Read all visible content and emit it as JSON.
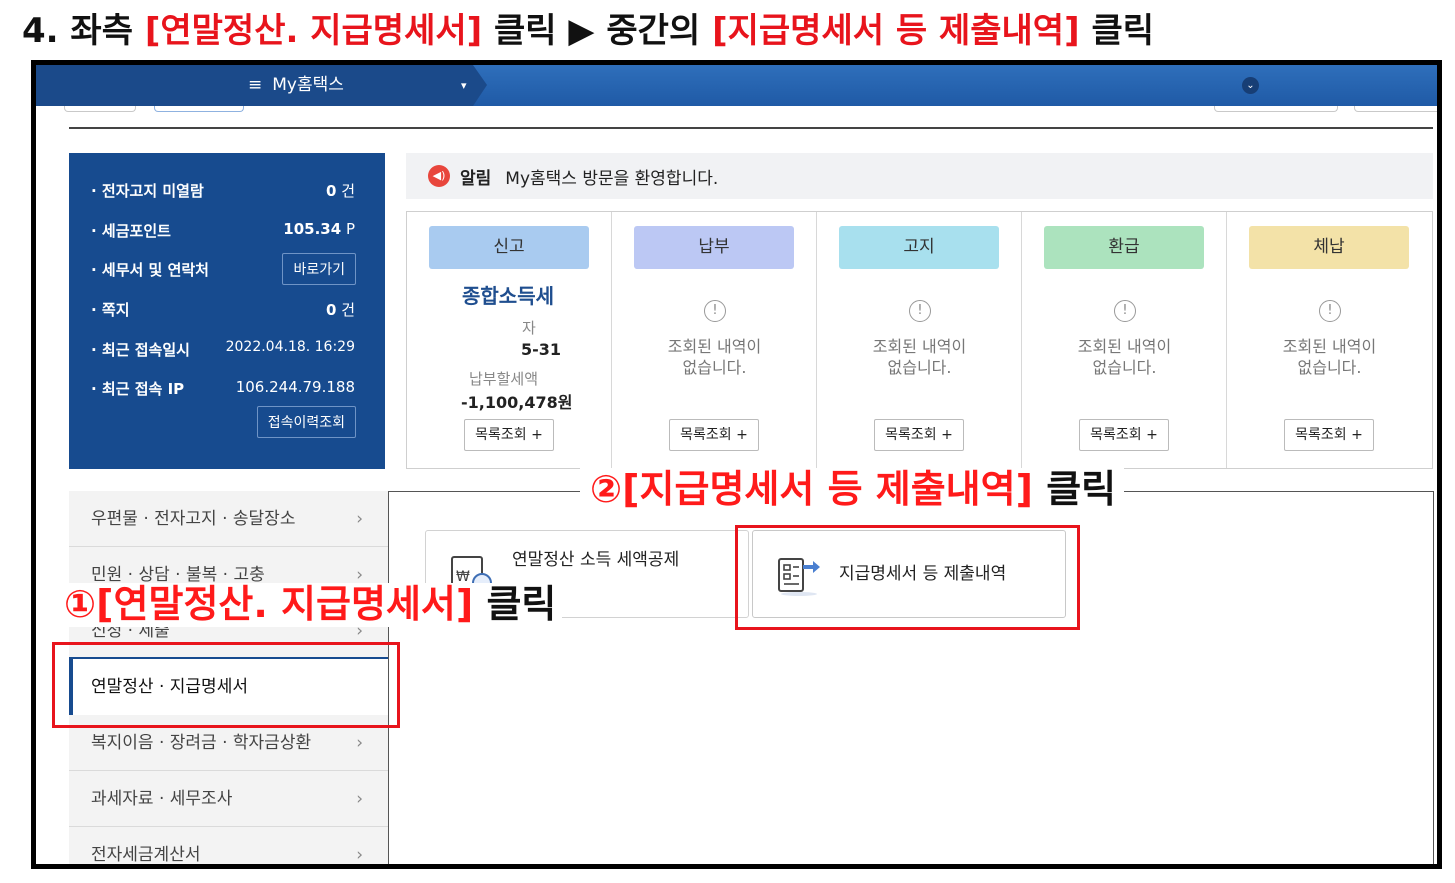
{
  "heading": {
    "prefix": "4. 좌측 ",
    "red1": "[연말정산. 지급명세서]",
    "mid": " 클릭 ▶ 중간의 ",
    "red2": "[지급명세서 등 제출내역]",
    "suffix": " 클릭"
  },
  "topbar": {
    "menu_icon": "hamburger-icon",
    "menu_label": "My홈택스",
    "menu_glyph": "≡",
    "caret_glyph": "▾",
    "dd_glyph": "⌄"
  },
  "info": {
    "rows": [
      {
        "label": "· 전자고지 미열람",
        "value": "0",
        "unit": "건"
      },
      {
        "label": "· 세금포인트",
        "value": "105.34",
        "unit": "P"
      },
      {
        "label": "· 세무서 및 연락처",
        "button": "바로가기"
      },
      {
        "label": "· 쪽지",
        "value": "0",
        "unit": "건"
      },
      {
        "label": "· 최근 접속일시",
        "value": "2022.04.18.  16:29"
      },
      {
        "label": "· 최근 접속 IP",
        "value": "106.244.79.188",
        "button": "접속이력조회"
      }
    ]
  },
  "notice": {
    "title": "알림",
    "message": "My홈택스 방문을 환영합니다.",
    "icon_glyph": "◀)"
  },
  "cards": [
    {
      "label": "신고",
      "color": "#a9cbf0",
      "detail": [
        "종합소득세",
        "자",
        "5-31",
        "납부할세액",
        "-1,100,478원"
      ],
      "list_button": "목록조회 +"
    },
    {
      "label": "납부",
      "color": "#bcc8f4",
      "empty": [
        "조회된 내역이",
        "없습니다."
      ],
      "list_button": "목록조회 +"
    },
    {
      "label": "고지",
      "color": "#a8e0ee",
      "empty": [
        "조회된 내역이",
        "없습니다."
      ],
      "list_button": "목록조회 +"
    },
    {
      "label": "환급",
      "color": "#ace3be",
      "empty": [
        "조회된 내역이",
        "없습니다."
      ],
      "list_button": "목록조회 +"
    },
    {
      "label": "체납",
      "color": "#f3e2a8",
      "empty": [
        "조회된 내역이",
        "없습니다."
      ],
      "list_button": "목록조회 +"
    }
  ],
  "warn_glyph": "!",
  "sidebar": {
    "items": [
      {
        "label": "우편물 · 전자고지 · 송달장소"
      },
      {
        "label": "민원 · 상담 · 불복 · 고충"
      },
      {
        "label": "신청 · 제출"
      },
      {
        "label": "연말정산 · 지급명세서",
        "active": true
      },
      {
        "label": "복지이음 · 장려금 · 학자금상환"
      },
      {
        "label": "과세자료 · 세무조사"
      },
      {
        "label": "전자세금계산서"
      }
    ],
    "arrow_glyph": "›"
  },
  "services": [
    {
      "label": "연말정산 소득 세액공제",
      "icon": "tax-deduction-icon"
    },
    {
      "label": "지급명세서 등 제출내역",
      "icon": "document-submit-icon"
    }
  ],
  "annotations": {
    "step1": {
      "num_red": "①[연말정산.",
      "red_rest": " 지급명세서]",
      "black": " 클릭"
    },
    "step2": {
      "red": "②[지급명세서 등 제출내역]",
      "black": " 클릭"
    }
  },
  "colors": {
    "accent_red": "#e8141c",
    "navy": "#174b8f",
    "topbar_blue": "#1f5aa6"
  }
}
